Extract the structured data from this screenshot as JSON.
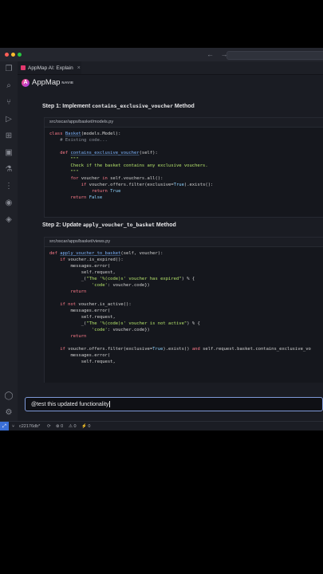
{
  "colors": {
    "accent": "#3a6fd8",
    "brand_pink": "#e3386e",
    "input_border": "#7f9ad9"
  },
  "window": {
    "traffic_lights": [
      "#ff5f57",
      "#febc2e",
      "#28c840"
    ],
    "nav_arrows": "← →"
  },
  "activity_icons": [
    "files-icon",
    "search-icon",
    "source-control-icon",
    "run-debug-icon",
    "extensions-icon",
    "remote-icon",
    "testing-icon",
    "appmap-icon",
    "database-icon",
    "docker-icon"
  ],
  "tab": {
    "label": "AppMap AI: Explain",
    "close": "×"
  },
  "brand": {
    "mark": "A",
    "name": "AppMap",
    "sub": "NAVIE"
  },
  "step1": {
    "title_prefix": "Step 1: Implement ",
    "title_code": "contains_exclusive_voucher",
    "title_suffix": " Method",
    "path": "src/oscar/apps/basket/models.py"
  },
  "step2": {
    "title_prefix": "Step 2: Update ",
    "title_code": "apply_voucher_to_basket",
    "title_suffix": " Method",
    "path": "src/oscar/apps/basket/views.py"
  },
  "input": {
    "value": "@test this updated functionality"
  },
  "status": {
    "branch": "c22176db*",
    "sync": "⟳",
    "errors": "⊗ 0",
    "warnings": "⚠ 0",
    "ports": "⚡ 0"
  }
}
